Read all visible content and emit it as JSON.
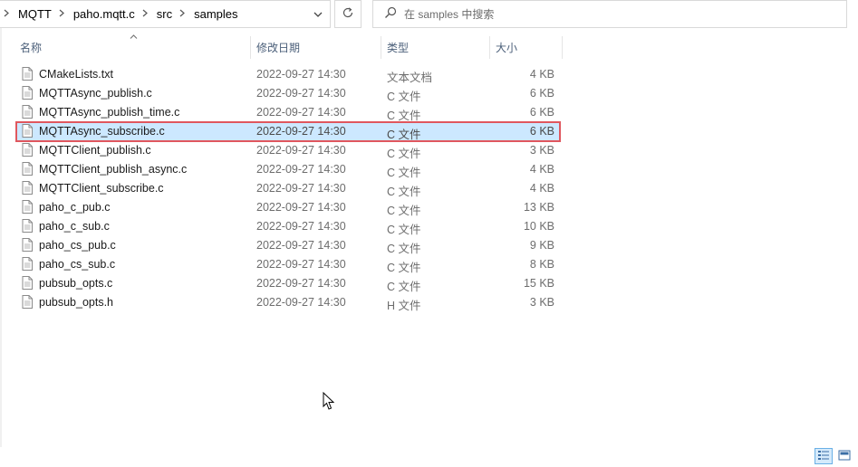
{
  "address": {
    "crumbs": [
      "MQTT",
      "paho.mqtt.c",
      "src",
      "samples"
    ]
  },
  "search": {
    "placeholder": "在 samples 中搜索"
  },
  "columns": {
    "name": "名称",
    "date": "修改日期",
    "type": "类型",
    "size": "大小"
  },
  "files": [
    {
      "name": "CMakeLists.txt",
      "date": "2022-09-27 14:30",
      "type": "文本文档",
      "size": "4 KB"
    },
    {
      "name": "MQTTAsync_publish.c",
      "date": "2022-09-27 14:30",
      "type": "C 文件",
      "size": "6 KB"
    },
    {
      "name": "MQTTAsync_publish_time.c",
      "date": "2022-09-27 14:30",
      "type": "C 文件",
      "size": "6 KB"
    },
    {
      "name": "MQTTAsync_subscribe.c",
      "date": "2022-09-27 14:30",
      "type": "C 文件",
      "size": "6 KB",
      "selected": true
    },
    {
      "name": "MQTTClient_publish.c",
      "date": "2022-09-27 14:30",
      "type": "C 文件",
      "size": "3 KB"
    },
    {
      "name": "MQTTClient_publish_async.c",
      "date": "2022-09-27 14:30",
      "type": "C 文件",
      "size": "4 KB"
    },
    {
      "name": "MQTTClient_subscribe.c",
      "date": "2022-09-27 14:30",
      "type": "C 文件",
      "size": "4 KB"
    },
    {
      "name": "paho_c_pub.c",
      "date": "2022-09-27 14:30",
      "type": "C 文件",
      "size": "13 KB"
    },
    {
      "name": "paho_c_sub.c",
      "date": "2022-09-27 14:30",
      "type": "C 文件",
      "size": "10 KB"
    },
    {
      "name": "paho_cs_pub.c",
      "date": "2022-09-27 14:30",
      "type": "C 文件",
      "size": "9 KB"
    },
    {
      "name": "paho_cs_sub.c",
      "date": "2022-09-27 14:30",
      "type": "C 文件",
      "size": "8 KB"
    },
    {
      "name": "pubsub_opts.c",
      "date": "2022-09-27 14:30",
      "type": "C 文件",
      "size": "15 KB"
    },
    {
      "name": "pubsub_opts.h",
      "date": "2022-09-27 14:30",
      "type": "H 文件",
      "size": "3 KB"
    }
  ],
  "icons": {
    "file": "document-icon",
    "breadcrumb_separator": "chevron-right-icon",
    "address_dropdown": "chevron-down-icon",
    "refresh": "refresh-icon",
    "search": "search-icon",
    "sort": "sort-ascending-icon",
    "view_details": "details-view-icon",
    "view_tiles": "large-icons-view-icon"
  },
  "colors": {
    "selection_bg": "#cce8ff",
    "selection_outline": "#e0575e",
    "header_text": "#4c607a"
  }
}
